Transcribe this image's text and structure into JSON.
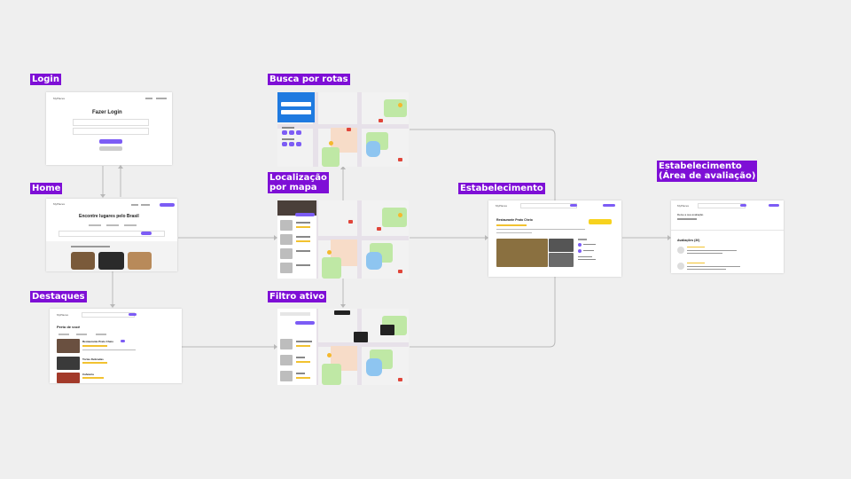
{
  "labels": {
    "login": "Login",
    "home": "Home",
    "destaques": "Destaques",
    "busca": "Busca por rotas",
    "localizacao": "Localização\npor mapa",
    "filtro": "Filtro ativo",
    "estabelecimento": "Estabelecimento",
    "avaliacao": "Estabelecimento\n(Área de avaliação)"
  },
  "login_frame": {
    "logo": "MyPlaces",
    "title": "Fazer Login"
  },
  "home_frame": {
    "logo": "MyPlaces",
    "headline": "Encontre lugares pelo Brasil"
  },
  "destaques_frame": {
    "logo": "MyPlaces",
    "section": "Perto de você",
    "items": [
      {
        "name": "Restaurante Prato Cheio"
      },
      {
        "name": "Tortas Delicadas"
      },
      {
        "name": "Cafeteria"
      }
    ]
  },
  "estab_frame": {
    "logo": "MyPlaces",
    "name": "Restaurante Prato Cheio"
  },
  "aval_frame": {
    "logo": "MyPlaces",
    "prompt": "Deixe a sua avaliação",
    "reviews_title": "Avaliações (30)"
  },
  "colors": {
    "background": "#efefef",
    "label_bg": "#7e0fd6",
    "accent": "#7c5cf5",
    "connector": "#b8b8b8",
    "button_yellow": "#f7d21e",
    "map_blue_panel": "#1f7ae0"
  }
}
